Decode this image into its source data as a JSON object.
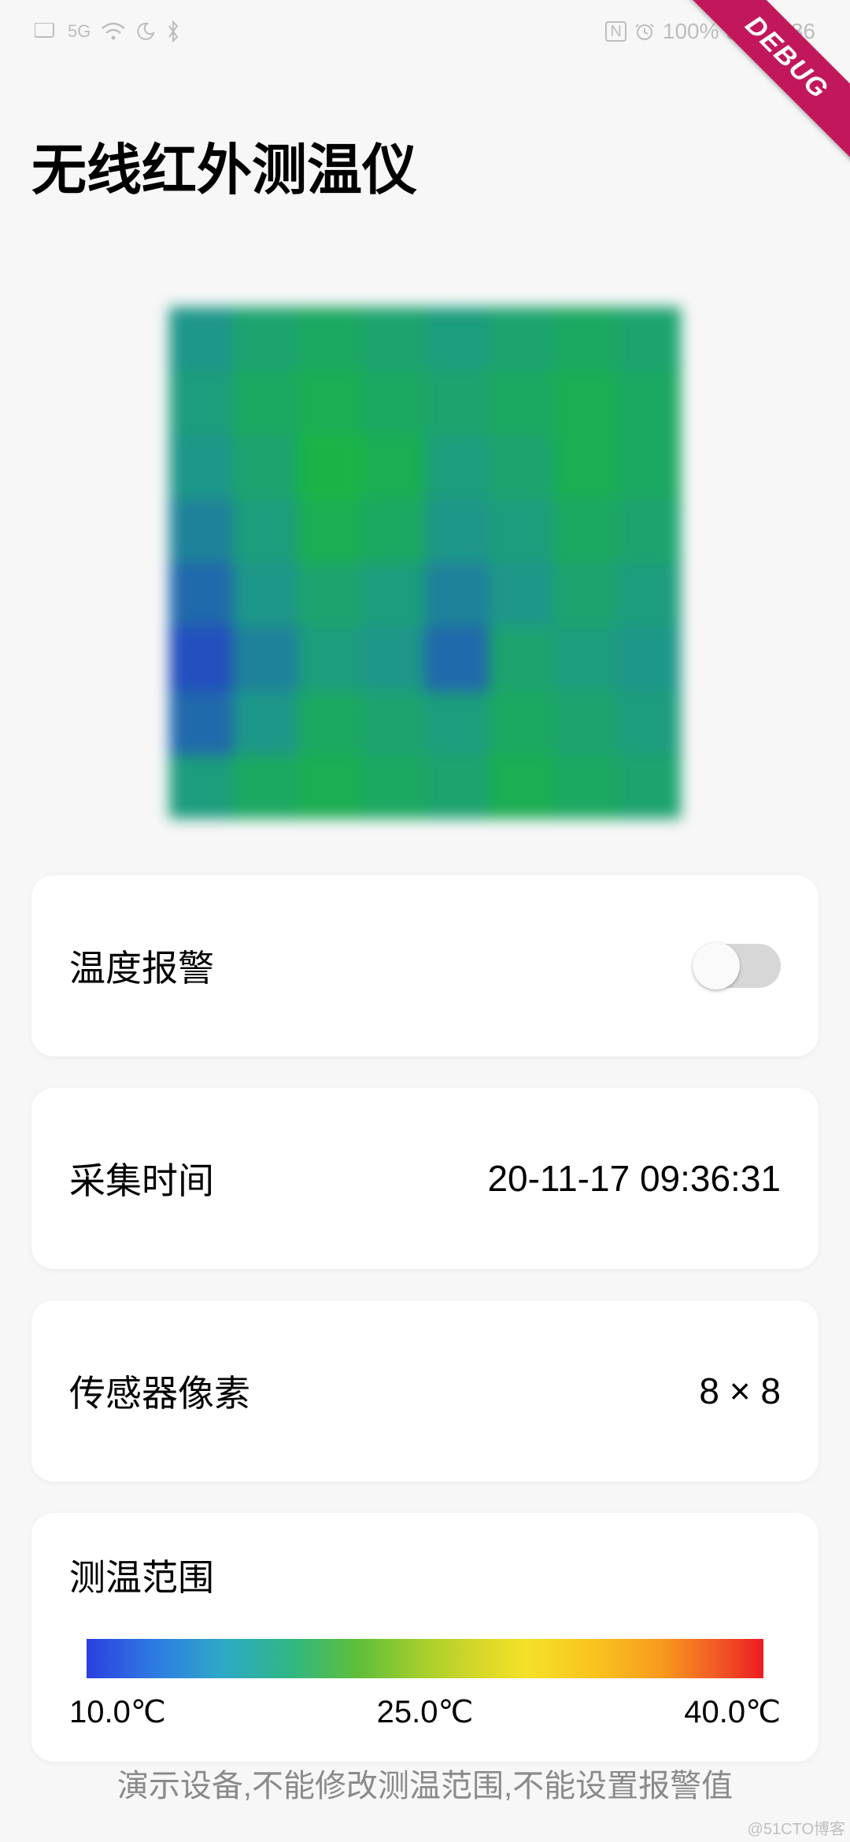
{
  "status_bar": {
    "nfc": "N",
    "battery_pct": "100%",
    "time": "9:36"
  },
  "debug_ribbon": "DEBUG",
  "page_title": "无线红外测温仪",
  "heatmap": {
    "grid": [
      [
        16,
        18,
        19,
        18,
        17,
        18,
        19,
        18
      ],
      [
        17,
        19,
        20,
        19,
        18,
        19,
        20,
        19
      ],
      [
        16,
        18,
        21,
        20,
        17,
        18,
        20,
        19
      ],
      [
        15,
        17,
        20,
        19,
        16,
        17,
        19,
        18
      ],
      [
        14,
        16,
        18,
        17,
        15,
        16,
        18,
        17
      ],
      [
        13,
        15,
        17,
        16,
        14,
        18,
        17,
        16
      ],
      [
        14,
        16,
        19,
        18,
        17,
        19,
        18,
        17
      ],
      [
        17,
        19,
        20,
        19,
        18,
        20,
        19,
        18
      ]
    ],
    "min": 10,
    "max": 40
  },
  "cards": {
    "alarm": {
      "label": "温度报警",
      "enabled": false
    },
    "capture_time": {
      "label": "采集时间",
      "value": "20-11-17 09:36:31"
    },
    "sensor_pixels": {
      "label": "传感器像素",
      "value": "8 × 8"
    },
    "range": {
      "label": "测温范围",
      "low": "10.0℃",
      "mid": "25.0℃",
      "high": "40.0℃"
    }
  },
  "footer": "演示设备,不能修改测温范围,不能设置报警值",
  "watermark": "@51CTO博客"
}
